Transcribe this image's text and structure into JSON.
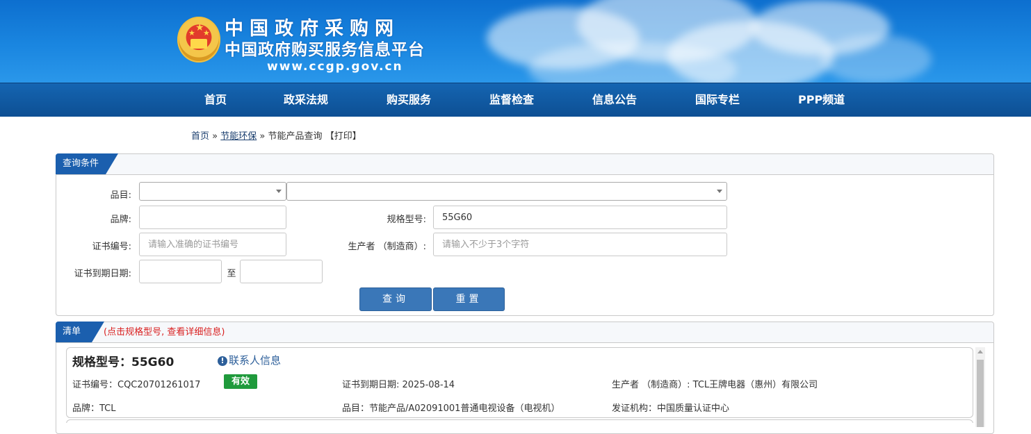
{
  "header": {
    "site_title": "中国政府采购网",
    "site_subtitle": "中国政府购买服务信息平台",
    "site_url": "www.ccgp.gov.cn"
  },
  "nav": [
    "首页",
    "政采法规",
    "购买服务",
    "监督检查",
    "信息公告",
    "国际专栏",
    "PPP频道"
  ],
  "breadcrumb": {
    "home": "首页",
    "sep": "»",
    "section": "节能环保",
    "current": "节能产品查询",
    "print": "【打印】"
  },
  "query": {
    "tab_label": "查询条件",
    "category_label": "品目:",
    "category_value": "",
    "category_sub_value": "",
    "brand_label": "品牌:",
    "brand_value": "",
    "model_label": "规格型号:",
    "model_value": "55G60",
    "cert_no_label": "证书编号:",
    "cert_no_placeholder": "请输入准确的证书编号",
    "maker_label": "生产者 （制造商）:",
    "maker_placeholder": "请输入不少于3个字符",
    "expiry_label": "证书到期日期:",
    "expiry_from": "",
    "expiry_to_sep": "至",
    "expiry_to": "",
    "search_button": "查询",
    "reset_button": "重置"
  },
  "results": {
    "tab_label": "清单",
    "hint": "(点击规格型号, 查看详细信息)",
    "items": [
      {
        "model_title": "规格型号：55G60",
        "contact_link": "联系人信息",
        "cert_no": "证书编号：CQC20701261017",
        "status": "有效",
        "expiry": "证书到期日期: 2025-08-14",
        "maker": "生产者 （制造商）: TCL王牌电器（惠州）有限公司",
        "brand": "品牌：TCL",
        "category": "品目：节能产品/A02091001普通电视设备（电视机）",
        "issuer": "发证机构：中国质量认证中心"
      }
    ]
  },
  "colors": {
    "banner": "#1a86e0",
    "nav": "#0d4f93",
    "tab": "#1b5fae",
    "button": "#3a77b8",
    "badge": "#1f9a3c",
    "hint": "#d92020"
  }
}
